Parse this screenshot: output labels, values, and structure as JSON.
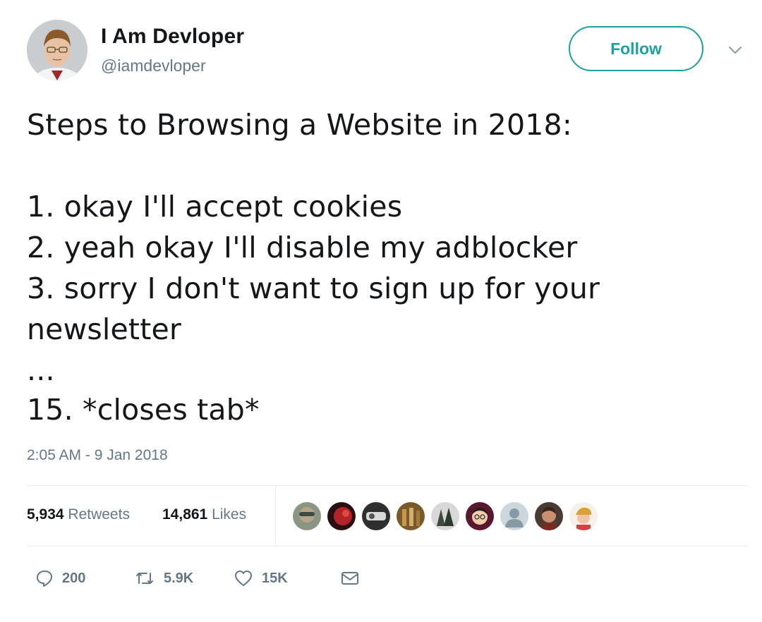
{
  "header": {
    "display_name": "I Am Devloper",
    "handle": "@iamdevloper",
    "follow_label": "Follow"
  },
  "tweet": {
    "lines": [
      "Steps to Browsing a Website in 2018:",
      "",
      "1. okay I'll accept cookies",
      "2. yeah okay I'll disable my adblocker",
      "3. sorry I don't want to sign up for your",
      "newsletter",
      "...",
      "15. *closes tab*"
    ],
    "timestamp": "2:05 AM - 9 Jan 2018"
  },
  "stats": {
    "retweets_count": "5,934",
    "retweets_label": "Retweets",
    "likes_count": "14,861",
    "likes_label": "Likes"
  },
  "likers": [
    {
      "icon": "avatar-1",
      "color": "#7d8a72"
    },
    {
      "icon": "avatar-2",
      "color": "#8a1e1e"
    },
    {
      "icon": "avatar-3",
      "color": "#3b3b3b"
    },
    {
      "icon": "avatar-4",
      "color": "#9b7a3c"
    },
    {
      "icon": "avatar-5",
      "color": "#5e6b5a"
    },
    {
      "icon": "avatar-6",
      "color": "#5a1730"
    },
    {
      "icon": "default-avatar",
      "color": "#ccd6dd"
    },
    {
      "icon": "avatar-8",
      "color": "#6b4a3a"
    },
    {
      "icon": "avatar-9",
      "color": "#e9b8a8"
    }
  ],
  "actions": {
    "reply_count": "200",
    "retweet_count": "5.9K",
    "like_count": "15K"
  },
  "colors": {
    "accent": "#1da1a0",
    "secondary_text": "#657786",
    "primary_text": "#14171a",
    "divider": "#e6ecf0"
  }
}
